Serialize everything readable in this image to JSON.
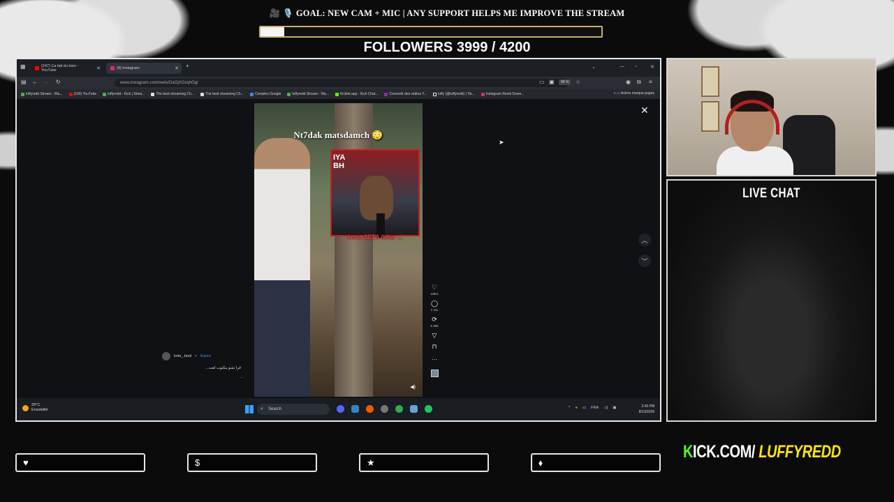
{
  "overlay": {
    "goal_text": "🎥 🎙️ GOAL: NEW CAM + MIC | ANY SUPPORT HELPS ME IMPROVE THE STREAM",
    "goal_progress": 0.07,
    "followers_text": "FOLLOWERS 3999 / 4200",
    "live_chat_title": "LIVE CHAT",
    "kick_prefix": "K",
    "kick_mid": "ICK.COM/",
    "kick_name": "LUFFYREDD",
    "buttons": [
      {
        "icon": "heart-icon",
        "glyph": "♥"
      },
      {
        "icon": "dollar-icon",
        "glyph": "$"
      },
      {
        "icon": "star-icon",
        "glyph": "★"
      },
      {
        "icon": "drop-icon",
        "glyph": "⬧"
      }
    ]
  },
  "browser": {
    "tabs": [
      {
        "title": "(247) Ca fait du bien - YouTube",
        "favicon_color": "#ff0000"
      },
      {
        "title": "(8) Instagram",
        "favicon_color": "#d62976"
      }
    ],
    "url": "www.instagram.com/reels/DaOjXGzqhGg/",
    "zoom": "90 %",
    "bookmarks": [
      "luffyredd Stream - Wa...",
      "(100) YouTube",
      "luffyredd - Kick | Strea...",
      "The best streaming Ch...",
      "The best streaming Ch...",
      "Comptes Google",
      "luffyredd Stream - Wa...",
      "Kicklet.app - Kick Chat...",
      "Convertir des vidéos Y...",
      "luffy (@luffyredd) | Tik...",
      "Instagram Reels Down..."
    ],
    "bookmarks_other": "Autres marque-pages"
  },
  "reel": {
    "caption": "Nt7dak matsdamch 😳",
    "inset_tag": "IYA\nBH",
    "inset_subtitle": "kmat 3ETA lkher ...",
    "author": "krim_.bool",
    "follow_label": "Suivre",
    "description": "قرا شنو مكتوب لعت...",
    "more": "...",
    "likes": "108 k",
    "comments": "1 111",
    "reposts": "5 305"
  },
  "taskbar": {
    "temp": "29°C",
    "weather": "Ensoleillé",
    "search_placeholder": "Search",
    "lang": "FRA",
    "time": "2:43 PM",
    "date": "8/13/2026"
  }
}
